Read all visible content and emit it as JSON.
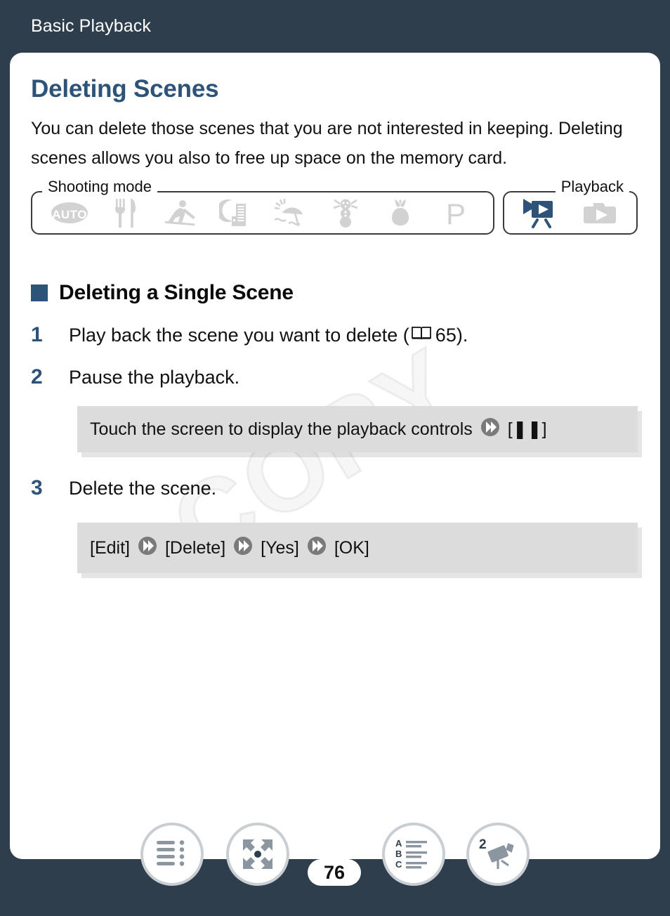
{
  "header": {
    "title": "Basic Playback"
  },
  "page": {
    "heading": "Deleting Scenes",
    "intro": "You can delete those scenes that you are not interested in keeping. Deleting scenes allows you also to free up space on the memory card.",
    "watermark": "COPY",
    "page_number": "76"
  },
  "mode_bar": {
    "shooting_label": "Shooting mode",
    "playback_label": "Playback",
    "shooting_icons": [
      {
        "name": "auto-mode-icon",
        "label": "AUTO",
        "active": false
      },
      {
        "name": "food-mode-icon",
        "label": "Food",
        "active": false
      },
      {
        "name": "sports-mode-icon",
        "label": "Sports",
        "active": false
      },
      {
        "name": "night-scene-mode-icon",
        "label": "Night Scene",
        "active": false
      },
      {
        "name": "beach-mode-icon",
        "label": "Beach",
        "active": false
      },
      {
        "name": "snow-mode-icon",
        "label": "Snow",
        "active": false
      },
      {
        "name": "macro-flower-mode-icon",
        "label": "Macro",
        "active": false
      },
      {
        "name": "program-mode-icon",
        "label": "P",
        "active": false
      }
    ],
    "playback_icons": [
      {
        "name": "movie-playback-icon",
        "label": "Movie Playback",
        "active": true
      },
      {
        "name": "photo-playback-icon",
        "label": "Photo Playback",
        "active": false
      }
    ],
    "active_color": "#2d5478",
    "inactive_color": "#d2d2d2"
  },
  "section": {
    "heading": "Deleting a Single Scene",
    "steps": [
      {
        "number": "1",
        "text_before": "Play back the scene you want to delete (",
        "reference_page": "65",
        "text_after": ")."
      },
      {
        "number": "2",
        "text_before": "Pause the playback.",
        "reference_page": "",
        "text_after": ""
      },
      {
        "number": "3",
        "text_before": "Delete the scene.",
        "reference_page": "",
        "text_after": ""
      }
    ],
    "action_box_1": {
      "text": "Touch the screen to display the playback controls",
      "bracket": "[❚❚]"
    },
    "action_box_2": {
      "items": [
        "[Edit]",
        "[Delete]",
        "[Yes]",
        "[OK]"
      ]
    }
  },
  "footer": {
    "buttons": [
      {
        "name": "table-of-contents-button",
        "label": "Table of Contents"
      },
      {
        "name": "fullscreen-expand-button",
        "label": "Expand"
      },
      {
        "name": "alphabetical-index-button",
        "label": "Index"
      },
      {
        "name": "camera-reference-button",
        "label": "Reference 2"
      }
    ]
  },
  "colors": {
    "background": "#2e3e4d",
    "accent_blue": "#2d5478",
    "card": "#ffffff",
    "action_box": "#dcdcdc"
  }
}
